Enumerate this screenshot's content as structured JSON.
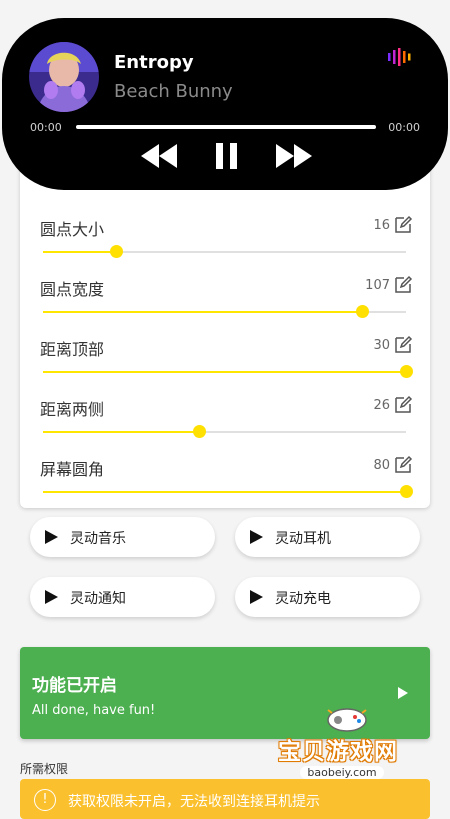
{
  "player": {
    "song": "Entropy",
    "artist": "Beach Bunny",
    "time_current": "00:00",
    "time_total": "00:00",
    "progress": 0,
    "wave_colors": [
      "#7b2cff",
      "#c026d3",
      "#ff2d87",
      "#ff6a00",
      "#ffb000"
    ]
  },
  "settings": [
    {
      "label": "圆点大小",
      "value": "16",
      "level": 0.2
    },
    {
      "label": "圆点宽度",
      "value": "107",
      "level": 0.88
    },
    {
      "label": "距离顶部",
      "value": "30",
      "level": 1.0
    },
    {
      "label": "距离两侧",
      "value": "26",
      "level": 0.43
    },
    {
      "label": "屏幕圆角",
      "value": "80",
      "level": 1.0
    }
  ],
  "features": [
    "灵动音乐",
    "灵动耳机",
    "灵动通知",
    "灵动充电"
  ],
  "status": {
    "title": "功能已开启",
    "subtitle": "All done, have fun!"
  },
  "permissions": {
    "title": "所需权限",
    "warning": "获取权限未开启，无法收到连接耳机提示"
  },
  "watermark": {
    "name": "宝贝游戏网",
    "url": "baobeiy.com"
  },
  "colors": {
    "slider": "#ffe600",
    "status_bg": "#4caf50",
    "warning_bg": "#fbc02d"
  }
}
